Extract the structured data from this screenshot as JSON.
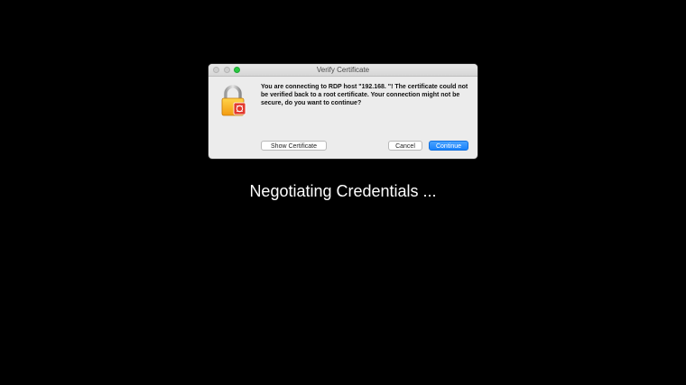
{
  "dialog": {
    "title": "Verify Certificate",
    "message": "You are connecting to RDP host \"192.168.            \"! The certificate could not be verified back to a root certificate. Your connection might not be secure, do you want to continue?",
    "buttons": {
      "show_certificate": "Show Certificate",
      "cancel": "Cancel",
      "continue": "Continue"
    },
    "icon": "lock-certificate-icon"
  },
  "status": {
    "text": "Negotiating Credentials ..."
  },
  "colors": {
    "background": "#000000",
    "accent": "#1a82fb",
    "zoom_button": "#28c940"
  }
}
